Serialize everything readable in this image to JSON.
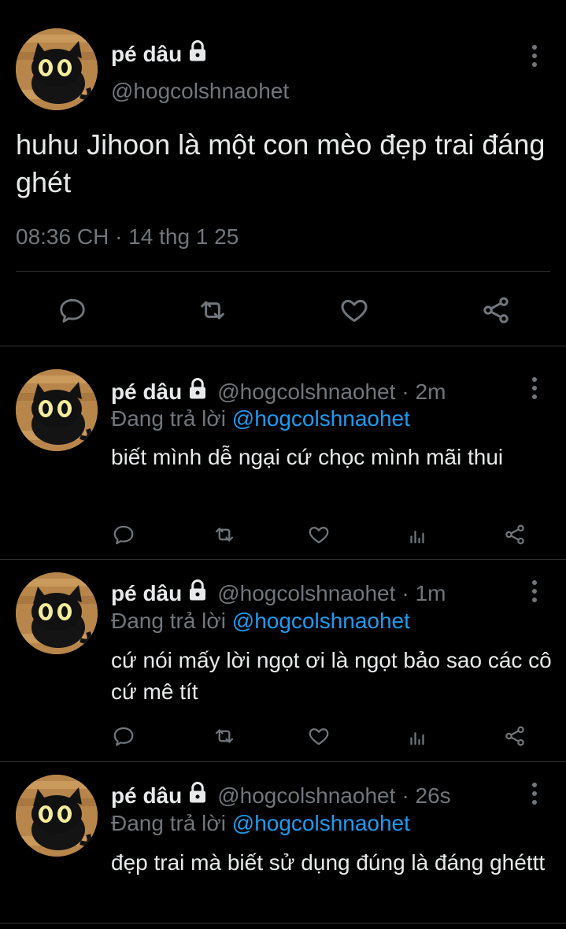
{
  "main_tweet": {
    "display_name": "pé dâu",
    "handle": "@hogcolshnaohet",
    "text": "huhu Jihoon là một con mèo đẹp trai đáng ghét",
    "timestamp": "08:36 CH · 14 thg 1 25",
    "icons": {
      "reply": "reply-icon",
      "retweet": "retweet-icon",
      "like": "like-icon",
      "share": "share-icon"
    }
  },
  "replies": [
    {
      "display_name": "pé dâu",
      "handle": "@hogcolshnaohet",
      "time": "· 2m",
      "replying_prefix": "Đang trả lời",
      "replying_to": "@hogcolshnaohet",
      "text": "biết mình dễ ngại cứ chọc mình mãi thui"
    },
    {
      "display_name": "pé dâu",
      "handle": "@hogcolshnaohet",
      "time": "· 1m",
      "replying_prefix": "Đang trả lời",
      "replying_to": "@hogcolshnaohet",
      "text": "cứ nói mấy lời ngọt ơi là ngọt bảo sao các cô cứ mê tít"
    },
    {
      "display_name": "pé dâu",
      "handle": "@hogcolshnaohet",
      "time": "· 26s",
      "replying_prefix": "Đang trả lời",
      "replying_to": "@hogcolshnaohet",
      "text": "đẹp trai mà biết sử dụng đúng là đáng ghéttt"
    }
  ],
  "colors": {
    "background": "#000000",
    "text": "#e7e9ea",
    "muted": "#71767b",
    "accent": "#1d9bf0",
    "divider": "#2f3336"
  }
}
